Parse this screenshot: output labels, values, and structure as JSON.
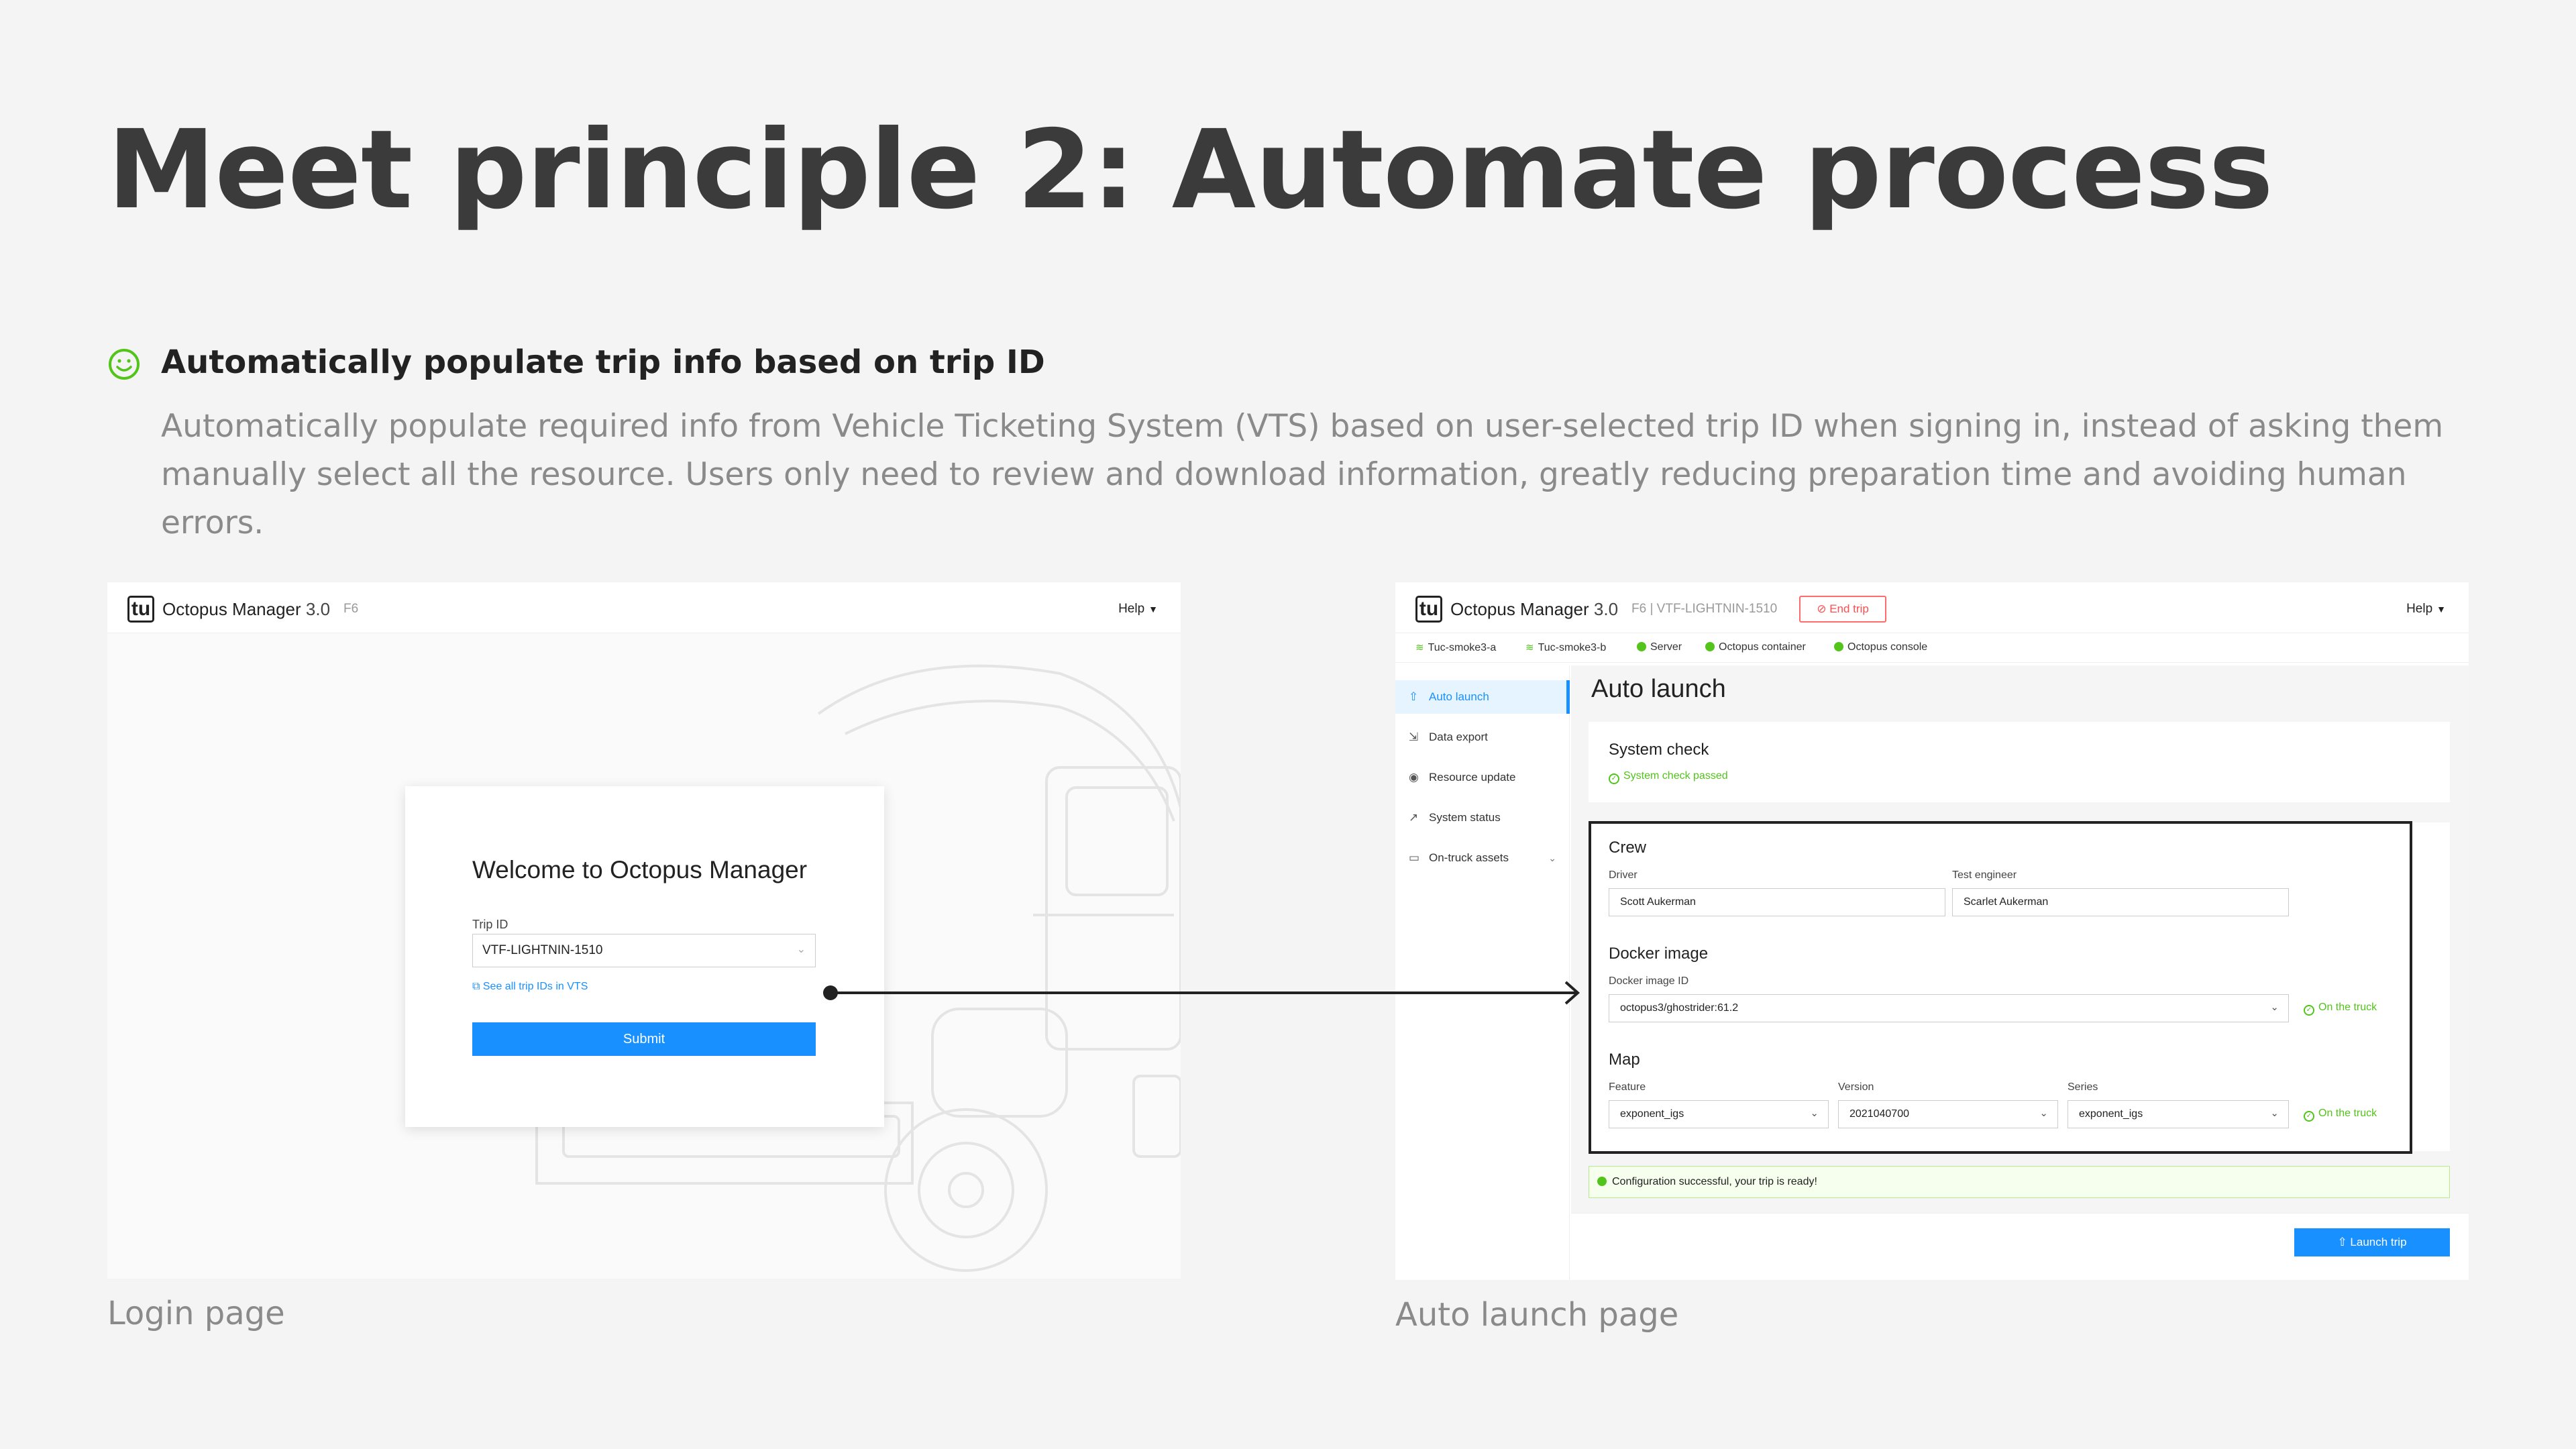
{
  "slide": {
    "title": "Meet principle 2: Automate process",
    "point_heading": "Automatically populate trip info based on trip ID",
    "point_description": "Automatically populate required info from Vehicle Ticketing System (VTS) based on user-selected trip ID when signing in, instead of asking them manually select all the resource. Users only need to review and download information, greatly reducing preparation time and avoiding human errors.",
    "login_caption": "Login page",
    "auto_caption": "Auto launch page"
  },
  "app": {
    "logo": "tu",
    "name": "Octopus Manager",
    "version": "3.0",
    "help": "Help"
  },
  "login": {
    "truck_tag": "F6",
    "welcome": "Welcome to Octopus Manager",
    "trip_label": "Trip ID",
    "trip_value": "VTF-LIGHTNIN-1510",
    "vts_link": "See all trip IDs in VTS",
    "submit": "Submit"
  },
  "auto": {
    "truck_trip_tag": "F6 | VTF-LIGHTNIN-1510",
    "end_trip": "End trip",
    "status": [
      "Tuc-smoke3-a",
      "Tuc-smoke3-b",
      "Server",
      "Octopus container",
      "Octopus console"
    ],
    "nav": [
      "Auto launch",
      "Data export",
      "Resource update",
      "System status",
      "On-truck assets"
    ],
    "page_title": "Auto launch",
    "system_check_title": "System check",
    "system_check_status": "System check passed",
    "crew_title": "Crew",
    "driver_label": "Driver",
    "driver_value": "Scott Aukerman",
    "engineer_label": "Test engineer",
    "engineer_value": "Scarlet Aukerman",
    "docker_title": "Docker image",
    "docker_label": "Docker image ID",
    "docker_value": "octopus3/ghostrider:61.2",
    "on_truck": "On the truck",
    "map_title": "Map",
    "feature_label": "Feature",
    "feature_value": "exponent_igs",
    "version_label": "Version",
    "version_value": "2021040700",
    "series_label": "Series",
    "series_value": "exponent_igs",
    "success": "Configuration successful, your trip is ready!",
    "launch": "Launch trip"
  },
  "colors": {
    "accent": "#1890ff",
    "success": "#52c41a",
    "danger": "#ff4d4f"
  }
}
